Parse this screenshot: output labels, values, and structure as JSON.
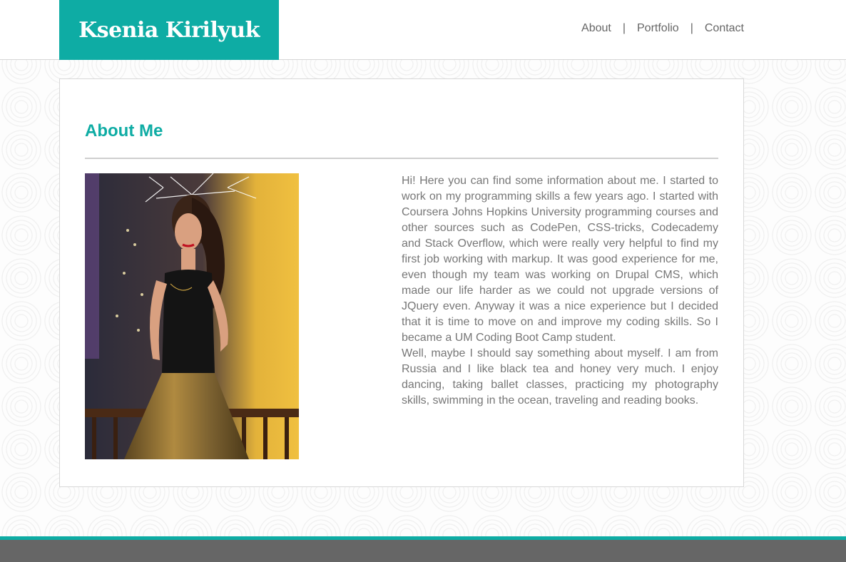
{
  "header": {
    "logo_text": "Ksenia Kirilyuk",
    "nav": [
      {
        "label": "About"
      },
      {
        "label": "Portfolio"
      },
      {
        "label": "Contact"
      }
    ],
    "separator": "|"
  },
  "main": {
    "title": "About Me",
    "bio_paragraphs": [
      "Hi! Here you can find some information about me. I started to work on my programming skills a few years ago. I started with Coursera Johns Hopkins University programming courses and other sources such as CodePen, CSS-tricks, Codecademy and Stack Overflow, which were really very helpful to find my first job working with markup. It was good experience for me, even though my team was working on Drupal CMS, which made our life harder as we could not upgrade versions of JQuery even. Anyway it was a nice experience but I decided that it is time to move on and improve my coding skills. So I became a UM Coding Boot Camp student.",
      "Well, maybe I should say something about myself. I am from Russia and I like black tea and honey very much. I enjoy dancing, taking ballet classes, practicing my photography skills, swimming in the ocean, traveling and reading books."
    ]
  },
  "colors": {
    "accent": "#0eaca4",
    "text": "#777777",
    "footer": "#666666"
  }
}
